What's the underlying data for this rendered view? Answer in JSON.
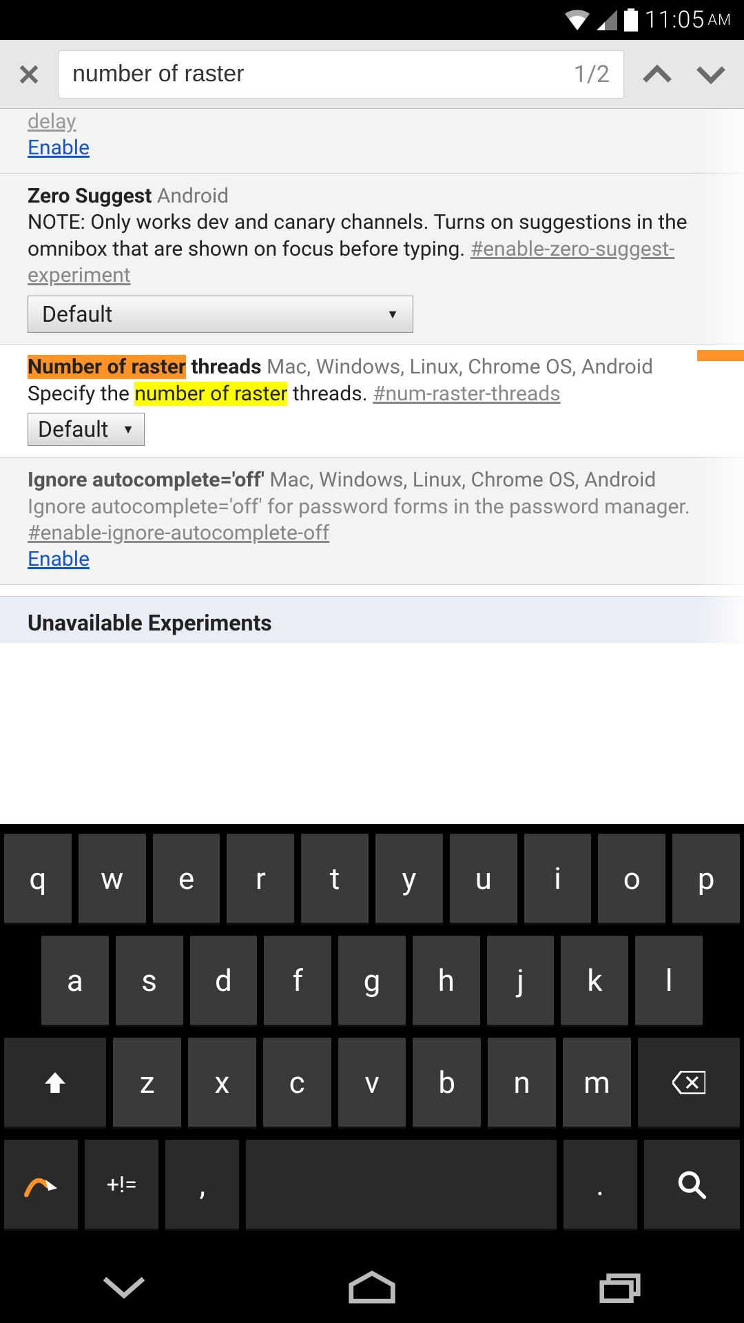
{
  "status": {
    "time": "11:05",
    "ampm": "AM"
  },
  "find": {
    "query": "number of raster",
    "counter": "1/2"
  },
  "flags": {
    "partial": {
      "clipped_text": "delay",
      "enable_label": "Enable"
    },
    "zero": {
      "title": "Zero Suggest",
      "platforms": "Android",
      "desc1": "NOTE: Only works dev and canary channels. Turns on suggestions in the omnibox that are shown on focus before typing. ",
      "hash": "#enable-zero-suggest-experiment",
      "select": "Default"
    },
    "raster": {
      "title_hl": "Number of raster",
      "title_rest": " threads",
      "platforms": "Mac, Windows, Linux, Chrome OS, Android",
      "desc_pre": "Specify the ",
      "desc_hl": "number of raster",
      "desc_post": " threads. ",
      "hash": "#num-raster-threads",
      "select": "Default"
    },
    "ignore": {
      "title": "Ignore autocomplete='off'",
      "platforms": "Mac, Windows, Linux, Chrome OS, Android",
      "desc": "Ignore autocomplete='off' for password forms in the password manager. ",
      "hash": "#enable-ignore-autocomplete-off",
      "enable_label": "Enable"
    },
    "section": "Unavailable Experiments"
  },
  "keyboard": {
    "row1": [
      "q",
      "w",
      "e",
      "r",
      "t",
      "y",
      "u",
      "i",
      "o",
      "p"
    ],
    "row2": [
      "a",
      "s",
      "d",
      "f",
      "g",
      "h",
      "j",
      "k",
      "l"
    ],
    "row3": [
      "z",
      "x",
      "c",
      "v",
      "b",
      "n",
      "m"
    ],
    "sym": "+!=",
    "comma": ",",
    "period": "."
  }
}
